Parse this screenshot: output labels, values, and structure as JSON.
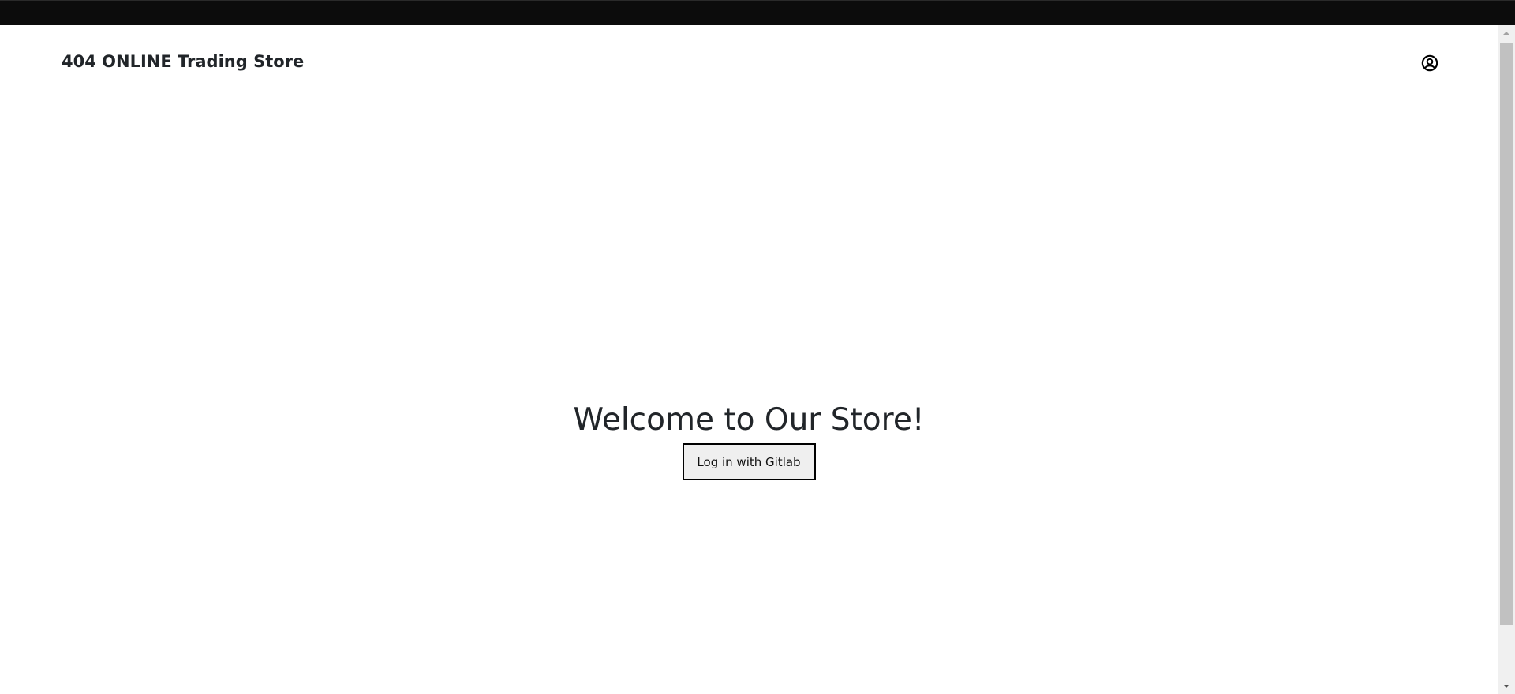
{
  "header": {
    "brand": "404 ONLINE Trading Store",
    "user_icon": "user-circle-icon"
  },
  "main": {
    "heading": "Welcome to Our Store!",
    "login_button": "Log in with Gitlab"
  }
}
